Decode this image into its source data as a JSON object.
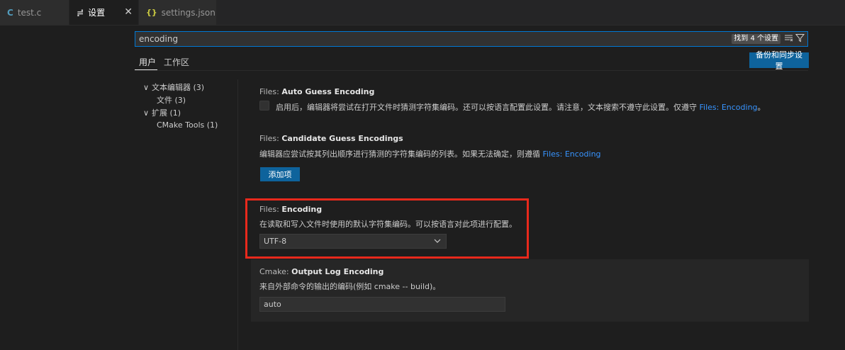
{
  "tabs": [
    {
      "icon": "C",
      "label": "test.c"
    },
    {
      "icon": "≓",
      "label": "设置",
      "close": "✕"
    },
    {
      "icon": "{}",
      "label": "settings.json"
    }
  ],
  "search": {
    "value": "encoding",
    "result_count": "找到 4 个设置"
  },
  "scope_tabs": [
    "用户",
    "工作区"
  ],
  "sync_button": "备份和同步设置",
  "toc": [
    {
      "chev": "∨",
      "label": "文本编辑器 (3)"
    },
    {
      "label": "文件 (3)"
    },
    {
      "chev": "∨",
      "label": "扩展 (1)"
    },
    {
      "label": "CMake Tools (1)"
    }
  ],
  "settings": {
    "auto_guess": {
      "category": "Files: ",
      "name": "Auto Guess Encoding",
      "desc": "启用后，编辑器将尝试在打开文件时猜测字符集编码。还可以按语言配置此设置。请注意，文本搜索不遵守此设置。仅遵守 ",
      "link": "Files: Encoding",
      "suffix": "。"
    },
    "candidate": {
      "category": "Files: ",
      "name": "Candidate Guess Encodings",
      "desc": "编辑器应尝试按其列出顺序进行猜测的字符集编码的列表。如果无法确定，则遵循 ",
      "link": "Files: Encoding",
      "add_button": "添加项"
    },
    "encoding": {
      "category": "Files: ",
      "name": "Encoding",
      "desc": "在读取和写入文件时使用的默认字符集编码。可以按语言对此项进行配置。",
      "value": "UTF-8"
    },
    "cmake": {
      "category": "Cmake: ",
      "name": "Output Log Encoding",
      "desc": "来自外部命令的输出的编码(例如 cmake -- build)。",
      "value": "auto"
    }
  },
  "colors": {
    "accent": "#0e639c",
    "link": "#3794ff",
    "highlight": "#e8291c"
  }
}
